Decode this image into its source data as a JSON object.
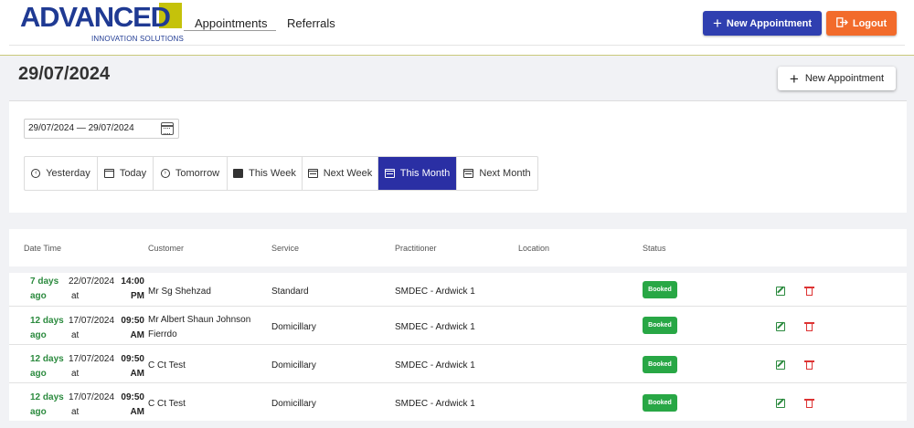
{
  "brand": {
    "name": "ADVANCED",
    "tagline": "INNOVATION SOLUTIONS",
    "color_primary": "#1f3a93",
    "color_accent": "#c5c20a"
  },
  "nav": {
    "items": [
      {
        "label": "Appointments",
        "active": true
      },
      {
        "label": "Referrals",
        "active": false
      }
    ]
  },
  "header_buttons": {
    "new_appointment": "New Appointment",
    "logout": "Logout",
    "new_icon": "plus-icon",
    "logout_icon": "logout-icon"
  },
  "page": {
    "title": "29/07/2024",
    "new_appointment": "New Appointment"
  },
  "filters": {
    "date_range": "29/07/2024 — 29/07/2024",
    "range_buttons": [
      {
        "label": "Yesterday",
        "icon": "arrow-left-circle-icon",
        "active": false
      },
      {
        "label": "Today",
        "icon": "calendar-icon",
        "active": false
      },
      {
        "label": "Tomorrow",
        "icon": "arrow-right-circle-icon",
        "active": false
      },
      {
        "label": "This Week",
        "icon": "calendar-week-icon",
        "active": false
      },
      {
        "label": "Next Week",
        "icon": "calendar-week-icon",
        "active": false
      },
      {
        "label": "This Month",
        "icon": "calendar-month-icon",
        "active": true
      },
      {
        "label": "Next Month",
        "icon": "calendar-month-icon",
        "active": false
      }
    ]
  },
  "table": {
    "headers": {
      "date_time": "Date Time",
      "customer": "Customer",
      "service": "Service",
      "practitioner": "Practitioner",
      "location": "Location",
      "status": "Status"
    },
    "rows": [
      {
        "ago_1": "7 days",
        "ago_2": "ago",
        "date": "22/07/2024",
        "time": "14:00",
        "at": "at",
        "period": "PM",
        "customer_1": "Mr Sg Shehzad",
        "customer_2": "",
        "service": "Standard",
        "practitioner": "SMDEC - Ardwick 1",
        "location": "",
        "status": "Booked"
      },
      {
        "ago_1": "12 days",
        "ago_2": "ago",
        "date": "17/07/2024",
        "time": "09:50",
        "at": "at",
        "period": "AM",
        "customer_1": "Mr Albert Shaun Johnson",
        "customer_2": "Fierrdo",
        "service": "Domicillary",
        "practitioner": "SMDEC - Ardwick 1",
        "location": "",
        "status": "Booked"
      },
      {
        "ago_1": "12 days",
        "ago_2": "ago",
        "date": "17/07/2024",
        "time": "09:50",
        "at": "at",
        "period": "AM",
        "customer_1": "C Ct Test",
        "customer_2": "",
        "service": "Domicillary",
        "practitioner": "SMDEC - Ardwick 1",
        "location": "",
        "status": "Booked"
      },
      {
        "ago_1": "12 days",
        "ago_2": "ago",
        "date": "17/07/2024",
        "time": "09:50",
        "at": "at",
        "period": "AM",
        "customer_1": "C Ct Test",
        "customer_2": "",
        "service": "Domicillary",
        "practitioner": "SMDEC - Ardwick 1",
        "location": "",
        "status": "Booked"
      }
    ],
    "status_color": "#28a745",
    "row_icons": {
      "edit": "edit-icon",
      "delete": "trash-icon"
    }
  }
}
